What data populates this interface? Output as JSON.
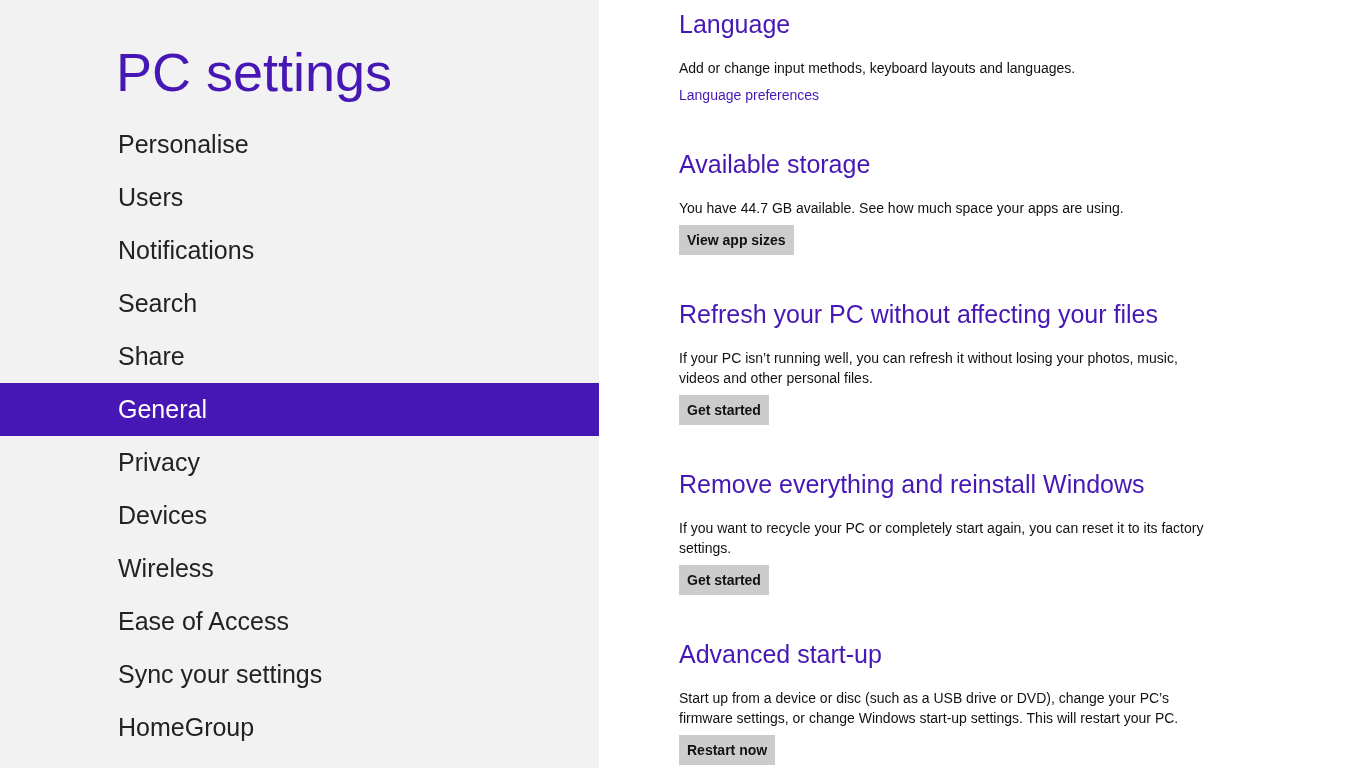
{
  "sidebar": {
    "title": "PC settings",
    "items": [
      {
        "label": "Personalise",
        "selected": false
      },
      {
        "label": "Users",
        "selected": false
      },
      {
        "label": "Notifications",
        "selected": false
      },
      {
        "label": "Search",
        "selected": false
      },
      {
        "label": "Share",
        "selected": false
      },
      {
        "label": "General",
        "selected": true
      },
      {
        "label": "Privacy",
        "selected": false
      },
      {
        "label": "Devices",
        "selected": false
      },
      {
        "label": "Wireless",
        "selected": false
      },
      {
        "label": "Ease of Access",
        "selected": false
      },
      {
        "label": "Sync your settings",
        "selected": false
      },
      {
        "label": "HomeGroup",
        "selected": false
      }
    ]
  },
  "sections": [
    {
      "heading": "Language",
      "description": "Add or change input methods, keyboard layouts and languages.",
      "action": {
        "kind": "link",
        "label": "Language preferences"
      }
    },
    {
      "heading": "Available storage",
      "description": "You have 44.7 GB available. See how much space your apps are using.",
      "action": {
        "kind": "button",
        "label": "View app sizes"
      }
    },
    {
      "heading": "Refresh your PC without affecting your files",
      "description": "If your PC isn’t running well, you can refresh it without losing your photos, music, videos and other personal files.",
      "action": {
        "kind": "button",
        "label": "Get started"
      }
    },
    {
      "heading": "Remove everything and reinstall Windows",
      "description": "If you want to recycle your PC or completely start again, you can reset it to its factory settings.",
      "action": {
        "kind": "button",
        "label": "Get started"
      }
    },
    {
      "heading": "Advanced start-up",
      "description": "Start up from a device or disc (such as a USB drive or DVD), change your PC’s firmware settings, or change Windows start-up settings. This will restart your PC.",
      "action": {
        "kind": "button",
        "label": "Restart now"
      }
    }
  ]
}
